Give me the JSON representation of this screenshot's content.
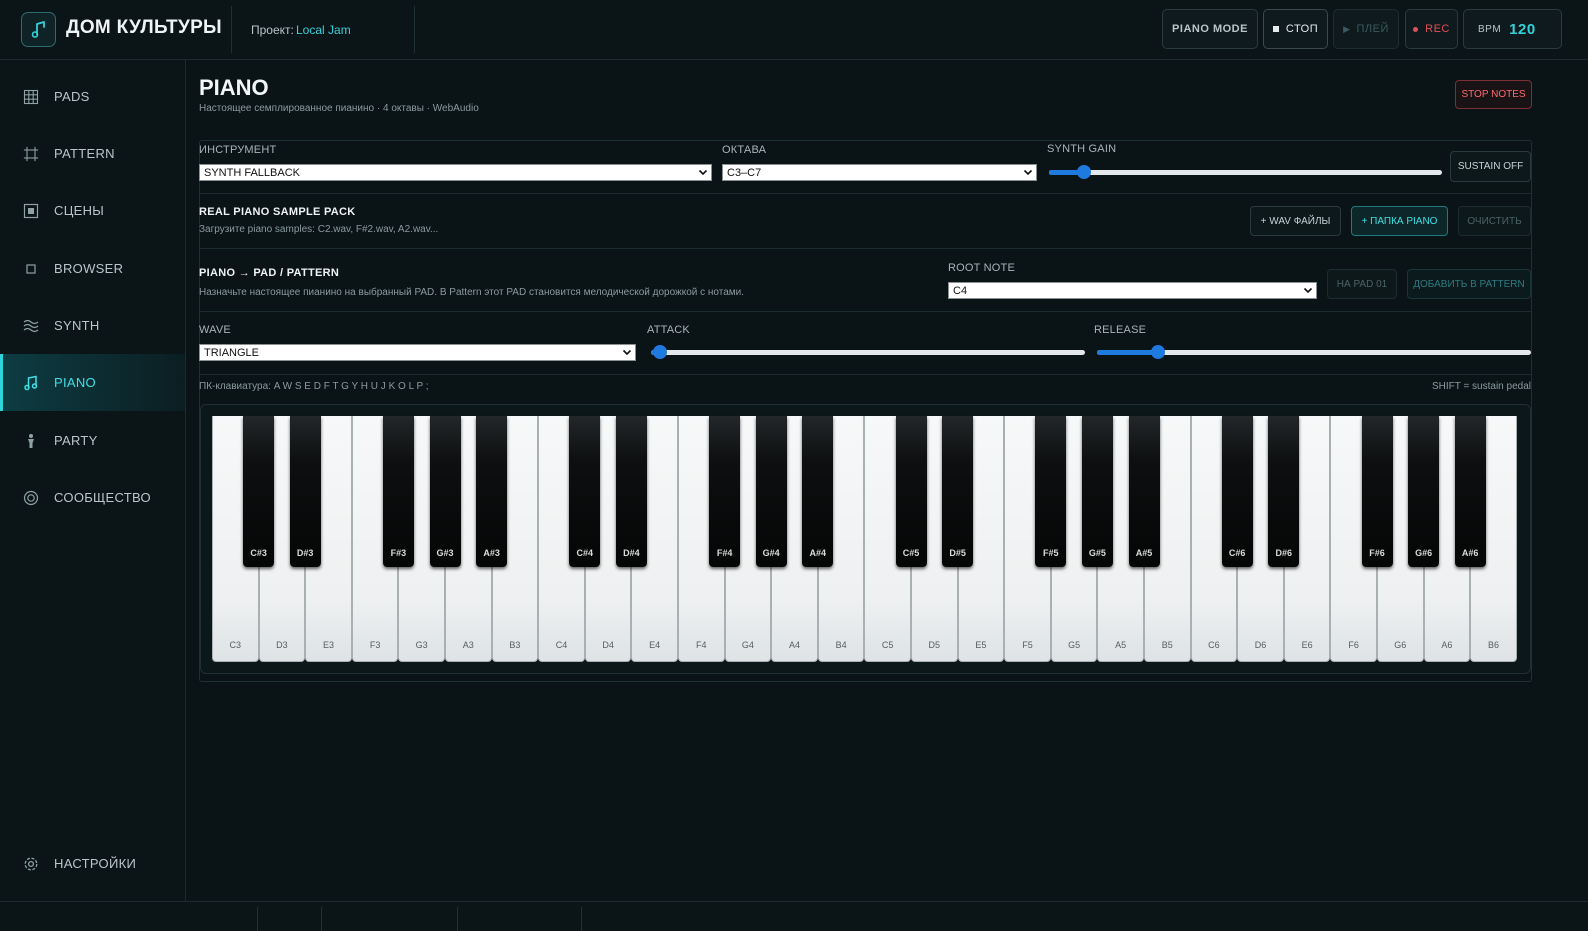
{
  "header": {
    "app_title": "ДОМ КУЛЬТУРЫ",
    "project_label": "Проект:",
    "project_name": "Local Jam",
    "piano_mode": "PIANO MODE",
    "stop": "СТОП",
    "play": "ПЛЕЙ",
    "rec": "REC",
    "bpm_label": "BPM",
    "bpm_value": "120"
  },
  "sidebar": {
    "items": [
      {
        "label": "PADS",
        "icon": "grid-icon"
      },
      {
        "label": "PATTERN",
        "icon": "crop-icon"
      },
      {
        "label": "СЦЕНЫ",
        "icon": "scene-icon"
      },
      {
        "label": "BROWSER",
        "icon": "square-icon"
      },
      {
        "label": "SYNTH",
        "icon": "wave-icon"
      },
      {
        "label": "PIANO",
        "icon": "music-note-icon",
        "active": true
      },
      {
        "label": "PARTY",
        "icon": "party-icon"
      },
      {
        "label": "СООБЩЕСТВО",
        "icon": "target-icon"
      }
    ],
    "settings": "НАСТРОЙКИ"
  },
  "page": {
    "title": "PIANO",
    "subtitle": "Настоящее семплированное пианино · 4 октавы · WebAudio",
    "stop_notes": "STOP NOTES"
  },
  "controls": {
    "instrument_label": "ИНСТРУМЕНТ",
    "instrument_value": "SYNTH FALLBACK",
    "octave_label": "ОКТАВА",
    "octave_value": "C3–C7",
    "gain_label": "SYNTH GAIN",
    "gain_value": 0.09,
    "sustain_button": "SUSTAIN OFF"
  },
  "sample_pack": {
    "title": "REAL PIANO SAMPLE PACK",
    "desc": "Загрузите piano samples: C2.wav, F#2.wav, A2.wav...",
    "wav_button": "+ WAV ФАЙЛЫ",
    "folder_button": "+ ПАПКА PIANO",
    "clear_button": "ОЧИСТИТЬ"
  },
  "pad_pattern": {
    "title": "PIANO → PAD / PATTERN",
    "desc": "Назначьте настоящее пианино на выбранный PAD. В Pattern этот PAD становится мелодической дорожкой с нотами.",
    "root_label": "ROOT NOTE",
    "root_value": "C4",
    "to_pad_button": "НА PAD 01",
    "add_pattern_button": "ДОБАВИТЬ В PATTERN"
  },
  "synth": {
    "wave_label": "WAVE",
    "wave_value": "TRIANGLE",
    "attack_label": "ATTACK",
    "attack_value": 0.02,
    "release_label": "RELEASE",
    "release_value": 0.14
  },
  "keyboard": {
    "hint": "ПК-клавиатура: A W S E D F T G Y H U J K O L P ;",
    "sustain_hint": "SHIFT = sustain pedal",
    "white_keys": [
      "C3",
      "D3",
      "E3",
      "F3",
      "G3",
      "A3",
      "B3",
      "C4",
      "D4",
      "E4",
      "F4",
      "G4",
      "A4",
      "B4",
      "C5",
      "D5",
      "E5",
      "F5",
      "G5",
      "A5",
      "B5",
      "C6",
      "D6",
      "E6",
      "F6",
      "G6",
      "A6",
      "B6"
    ],
    "black_keys": [
      "C#3",
      "D#3",
      "F#3",
      "G#3",
      "A#3",
      "C#4",
      "D#4",
      "F#4",
      "G#4",
      "A#4",
      "C#5",
      "D#5",
      "F#5",
      "G#5",
      "A#5",
      "C#6",
      "D#6",
      "F#6",
      "G#6",
      "A#6"
    ]
  },
  "colors": {
    "accent": "#35d1d9",
    "rec": "#e0505a",
    "slider": "#1f7ae0"
  }
}
